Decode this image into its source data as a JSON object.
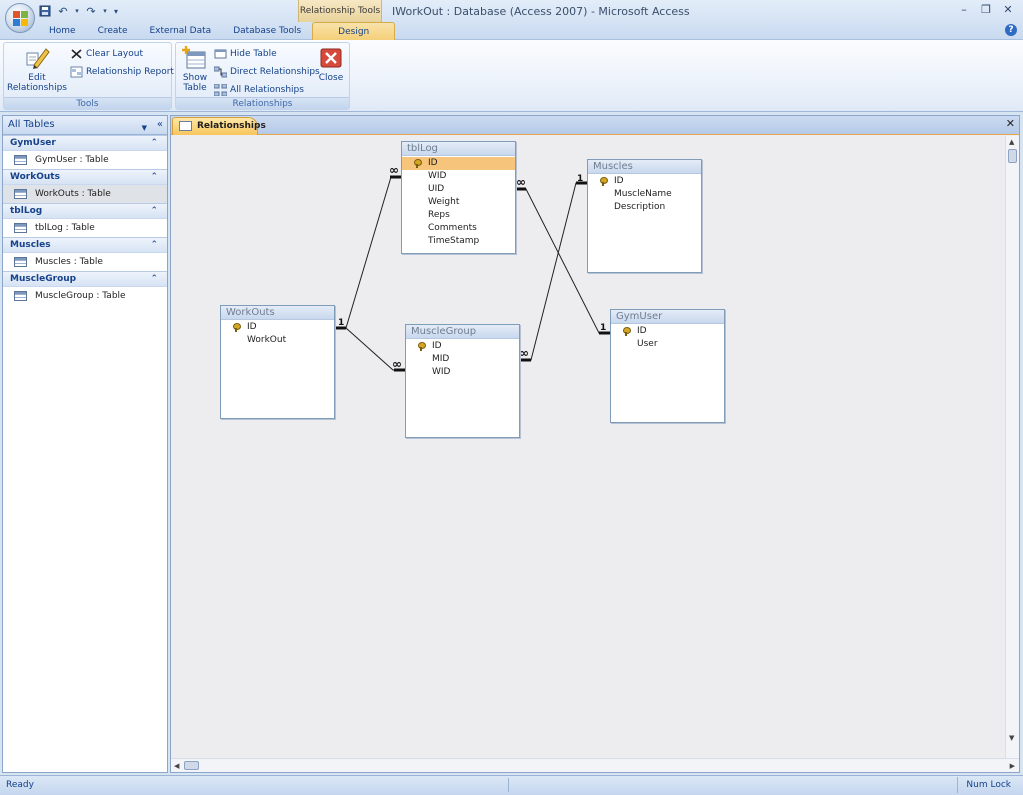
{
  "window": {
    "title": "IWorkOut : Database (Access 2007) - Microsoft Access",
    "context_tab_title": "Relationship Tools",
    "controls": {
      "minimize": "–",
      "restore": "❐",
      "close": "✕"
    }
  },
  "qat": {
    "save_icon": "save-icon",
    "undo_icon": "undo-icon",
    "redo_icon": "redo-icon",
    "customize_icon": "customize-qat-icon"
  },
  "ribbon": {
    "tabs": [
      {
        "label": "Home"
      },
      {
        "label": "Create"
      },
      {
        "label": "External Data"
      },
      {
        "label": "Database Tools"
      },
      {
        "label": "Design"
      }
    ],
    "groups": {
      "tools": {
        "label": "Tools",
        "edit_relationships": "Edit Relationships",
        "clear_layout": "Clear Layout",
        "relationship_report": "Relationship Report"
      },
      "relationships": {
        "label": "Relationships",
        "show_table": "Show Table",
        "hide_table": "Hide Table",
        "direct_relationships": "Direct Relationships",
        "all_relationships": "All Relationships",
        "close": "Close"
      }
    }
  },
  "nav": {
    "header": "All Tables",
    "groups": [
      {
        "name": "GymUser",
        "item": "GymUser : Table"
      },
      {
        "name": "WorkOuts",
        "item": "WorkOuts : Table"
      },
      {
        "name": "tblLog",
        "item": "tblLog : Table"
      },
      {
        "name": "Muscles",
        "item": "Muscles : Table"
      },
      {
        "name": "MuscleGroup",
        "item": "MuscleGroup : Table"
      }
    ]
  },
  "document": {
    "tab_label": "Relationships",
    "tables": [
      {
        "name": "tblLog",
        "fields": [
          "ID",
          "WID",
          "UID",
          "Weight",
          "Reps",
          "Comments",
          "TimeStamp"
        ],
        "selected_field": "ID"
      },
      {
        "name": "Muscles",
        "fields": [
          "ID",
          "MuscleName",
          "Description"
        ]
      },
      {
        "name": "WorkOuts",
        "fields": [
          "ID",
          "WorkOut"
        ]
      },
      {
        "name": "MuscleGroup",
        "fields": [
          "ID",
          "MID",
          "WID"
        ]
      },
      {
        "name": "GymUser",
        "fields": [
          "ID",
          "User"
        ]
      }
    ],
    "relationship_labels": {
      "one": "1",
      "many": "∞"
    }
  },
  "status": {
    "text": "Ready",
    "num_lock": "Num Lock"
  }
}
